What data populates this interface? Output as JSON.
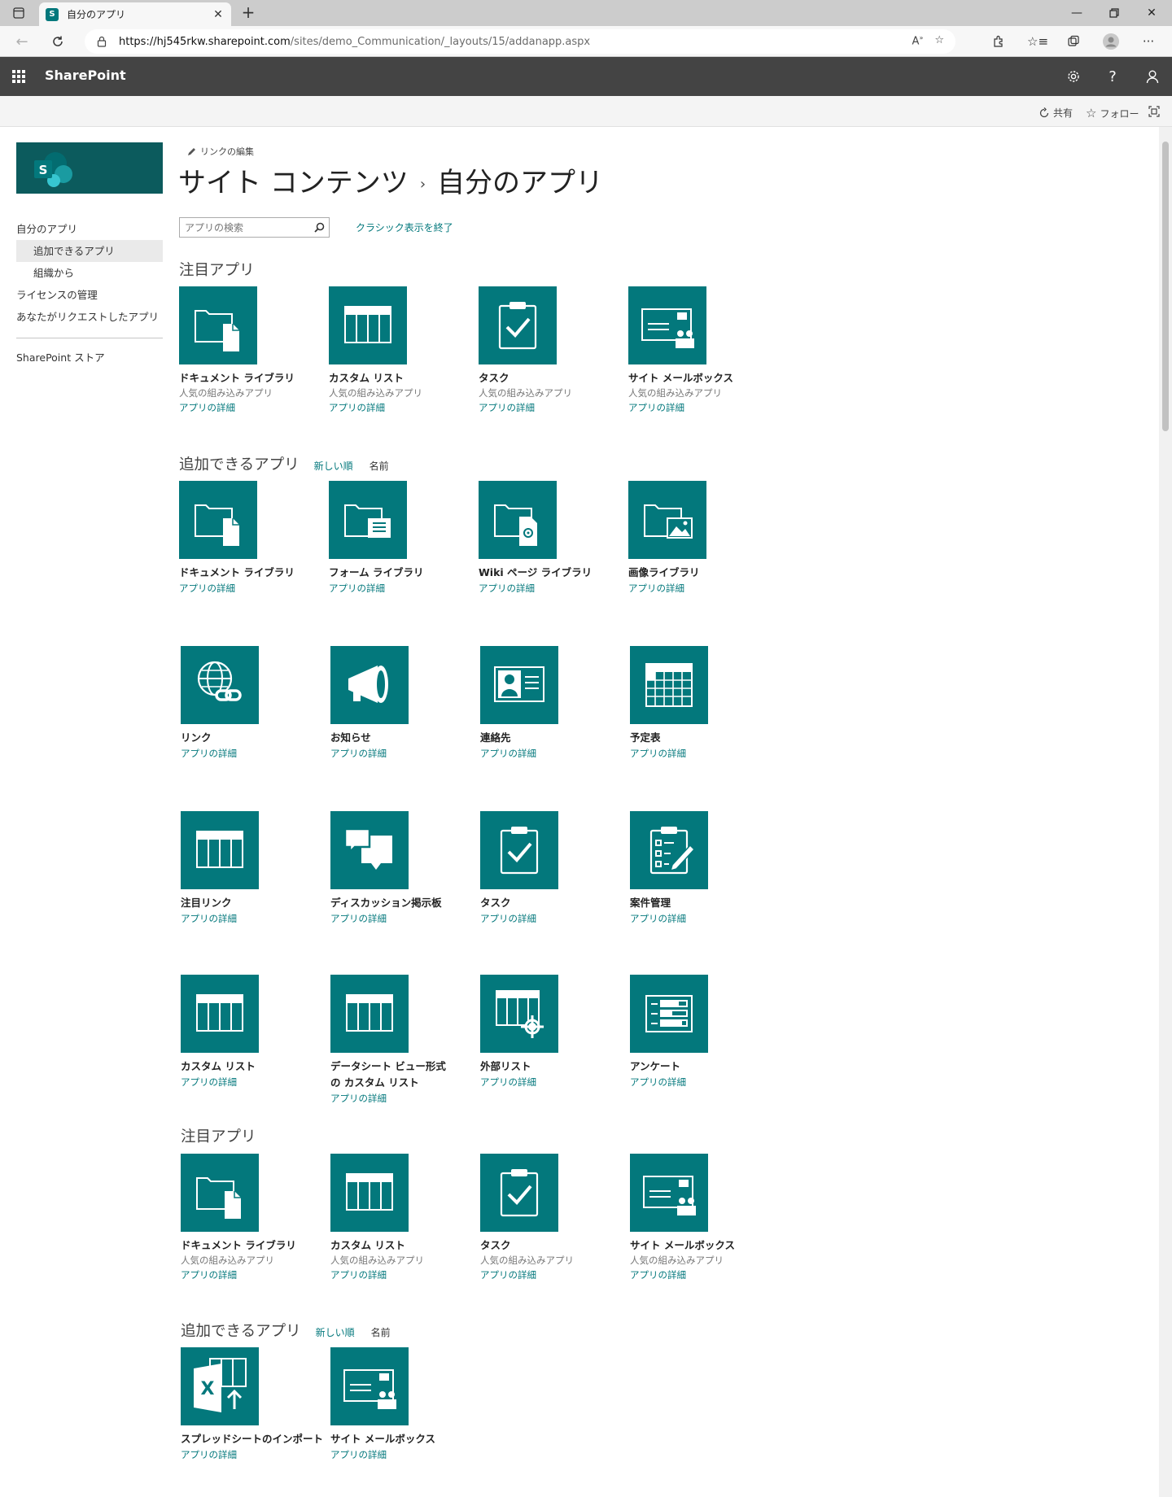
{
  "browser": {
    "tab_title": "自分のアプリ",
    "url_host": "https://hj545rkw.sharepoint.com",
    "url_path": "/sites/demo_Communication/_layouts/15/addanapp.aspx"
  },
  "suite": {
    "brand": "SharePoint"
  },
  "ribbon": {
    "share": "共有",
    "follow": "フォロー"
  },
  "leftnav": {
    "items": [
      {
        "label": "自分のアプリ"
      },
      {
        "label": "追加できるアプリ"
      },
      {
        "label": "組織から"
      },
      {
        "label": "ライセンスの管理"
      },
      {
        "label": "あなたがリクエストしたアプリ"
      }
    ],
    "store": "SharePoint ストア"
  },
  "main": {
    "edit_links": "リンクの編集",
    "title_part1": "サイト コンテンツ",
    "title_sep": "›",
    "title_part2": "自分のアプリ",
    "search_placeholder": "アプリの検索",
    "exit_classic": "クラシック表示を終了",
    "featured_heading": "注目アプリ",
    "available_heading": "追加できるアプリ",
    "sort_newest": "新しい順",
    "sort_name": "名前"
  },
  "apps": {
    "featured1": [
      {
        "name": "ドキュメント ライブラリ",
        "sub": "人気の組み込みアプリ",
        "link": "アプリの詳細",
        "icon": "document-library-icon"
      },
      {
        "name": "カスタム リスト",
        "sub": "人気の組み込みアプリ",
        "link": "アプリの詳細",
        "icon": "custom-list-icon"
      },
      {
        "name": "タスク",
        "sub": "人気の組み込みアプリ",
        "link": "アプリの詳細",
        "icon": "task-icon"
      },
      {
        "name": "サイト メールボックス",
        "sub": "人気の組み込みアプリ",
        "link": "アプリの詳細",
        "icon": "site-mailbox-icon"
      }
    ],
    "available": [
      {
        "name": "ドキュメント ライブラリ",
        "link": "アプリの詳細",
        "icon": "document-library-icon"
      },
      {
        "name": "フォーム ライブラリ",
        "link": "アプリの詳細",
        "icon": "form-library-icon"
      },
      {
        "name": "Wiki ページ ライブラリ",
        "link": "アプリの詳細",
        "icon": "wiki-library-icon"
      },
      {
        "name": "画像ライブラリ",
        "link": "アプリの詳細",
        "icon": "picture-library-icon"
      },
      {
        "name": "リンク",
        "link": "アプリの詳細",
        "icon": "links-icon"
      },
      {
        "name": "お知らせ",
        "link": "アプリの詳細",
        "icon": "announcements-icon"
      },
      {
        "name": "連絡先",
        "link": "アプリの詳細",
        "icon": "contacts-icon"
      },
      {
        "name": "予定表",
        "link": "アプリの詳細",
        "icon": "calendar-icon"
      },
      {
        "name": "注目リンク",
        "link": "アプリの詳細",
        "icon": "promoted-links-icon"
      },
      {
        "name": "ディスカッション掲示板",
        "link": "アプリの詳細",
        "icon": "discussion-board-icon"
      },
      {
        "name": "タスク",
        "link": "アプリの詳細",
        "icon": "task-icon"
      },
      {
        "name": "案件管理",
        "link": "アプリの詳細",
        "icon": "issue-tracking-icon"
      },
      {
        "name": "カスタム リスト",
        "link": "アプリの詳細",
        "icon": "custom-list-icon"
      },
      {
        "name": "データシート ビュー形式の カスタム リスト",
        "link": "アプリの詳細",
        "icon": "datasheet-list-icon"
      },
      {
        "name": "外部リスト",
        "link": "アプリの詳細",
        "icon": "external-list-icon"
      },
      {
        "name": "アンケート",
        "link": "アプリの詳細",
        "icon": "survey-icon"
      }
    ],
    "featured2": [
      {
        "name": "ドキュメント ライブラリ",
        "sub": "人気の組み込みアプリ",
        "link": "アプリの詳細",
        "icon": "document-library-icon"
      },
      {
        "name": "カスタム リスト",
        "sub": "人気の組み込みアプリ",
        "link": "アプリの詳細",
        "icon": "custom-list-icon"
      },
      {
        "name": "タスク",
        "sub": "人気の組み込みアプリ",
        "link": "アプリの詳細",
        "icon": "task-icon"
      },
      {
        "name": "サイト メールボックス",
        "sub": "人気の組み込みアプリ",
        "link": "アプリの詳細",
        "icon": "site-mailbox-icon"
      }
    ],
    "available2": [
      {
        "name": "スプレッドシートのインポート",
        "link": "アプリの詳細",
        "icon": "import-spreadsheet-icon"
      },
      {
        "name": "サイト メールボックス",
        "link": "アプリの詳細",
        "icon": "site-mailbox-icon"
      }
    ]
  },
  "colors": {
    "tile": "#03787c",
    "link": "#03787c",
    "suitebar": "#444444"
  }
}
